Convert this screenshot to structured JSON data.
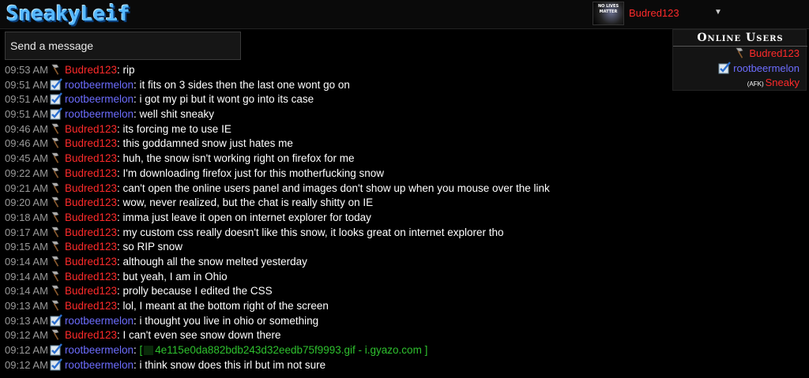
{
  "header": {
    "logo": "SneakyLeif",
    "avatar_text": "NO LIVES MATTER",
    "user_name": "Budred123",
    "caret": "▼"
  },
  "input": {
    "placeholder": "Send a message"
  },
  "online": {
    "title": "Online Users",
    "users": [
      {
        "name": "Budred123",
        "color": "#ff2a2a",
        "icon": "axe-icon",
        "afk": ""
      },
      {
        "name": "rootbeermelon",
        "color": "#6d6dff",
        "icon": "checkbox-icon",
        "afk": ""
      },
      {
        "name": "Sneaky",
        "color": "#ff2a2a",
        "icon": "",
        "afk": "(AFK)"
      }
    ]
  },
  "colors": {
    "budred": "#ff2a2a",
    "rootbeer": "#6d6dff",
    "link": "#2ec12e",
    "timestamp": "#9a9a9a"
  },
  "messages": [
    {
      "time": "09:53 AM",
      "user": "Budred123",
      "text": "rip"
    },
    {
      "time": "09:51 AM",
      "user": "rootbeermelon",
      "text": "it fits on 3 sides then the last one wont go on"
    },
    {
      "time": "09:51 AM",
      "user": "rootbeermelon",
      "text": "i got my pi but it wont go into its case"
    },
    {
      "time": "09:51 AM",
      "user": "rootbeermelon",
      "text": "well shit sneaky"
    },
    {
      "time": "09:46 AM",
      "user": "Budred123",
      "text": "its forcing me to use IE"
    },
    {
      "time": "09:46 AM",
      "user": "Budred123",
      "text": "this goddamned snow just hates me"
    },
    {
      "time": "09:45 AM",
      "user": "Budred123",
      "text": "huh, the snow isn't working right on firefox for me"
    },
    {
      "time": "09:22 AM",
      "user": "Budred123",
      "text": "I'm downloading firefox just for this motherfucking snow"
    },
    {
      "time": "09:21 AM",
      "user": "Budred123",
      "text": "can't open the online users panel and images don't show up when you mouse over the link"
    },
    {
      "time": "09:20 AM",
      "user": "Budred123",
      "text": "wow, never realized, but the chat is really shitty on IE"
    },
    {
      "time": "09:18 AM",
      "user": "Budred123",
      "text": "imma just leave it open on internet explorer for today"
    },
    {
      "time": "09:17 AM",
      "user": "Budred123",
      "text": "my custom css really doesn't like this snow, it looks great on internet explorer tho"
    },
    {
      "time": "09:15 AM",
      "user": "Budred123",
      "text": "so RIP snow"
    },
    {
      "time": "09:14 AM",
      "user": "Budred123",
      "text": "although all the snow melted yesterday"
    },
    {
      "time": "09:14 AM",
      "user": "Budred123",
      "text": "but yeah, I am in Ohio"
    },
    {
      "time": "09:14 AM",
      "user": "Budred123",
      "text": "prolly because I edited the CSS"
    },
    {
      "time": "09:13 AM",
      "user": "Budred123",
      "text": "lol, I meant at the bottom right of the screen"
    },
    {
      "time": "09:13 AM",
      "user": "rootbeermelon",
      "text": "i thought you live in ohio or something"
    },
    {
      "time": "09:12 AM",
      "user": "Budred123",
      "text": "I can't even see snow down there"
    },
    {
      "time": "09:12 AM",
      "user": "rootbeermelon",
      "text": "",
      "link": "4e115e0da882bdb243d32eedb75f9993.gif - i.gyazo.com",
      "link_open": "[",
      "link_close": "]"
    },
    {
      "time": "09:12 AM",
      "user": "rootbeermelon",
      "text": "i think snow does this irl but im not sure"
    }
  ]
}
